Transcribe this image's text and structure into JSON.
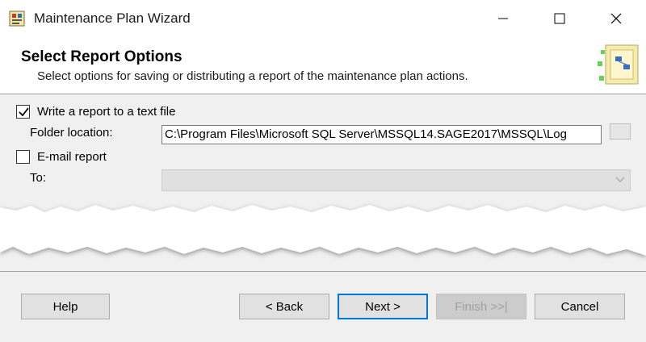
{
  "window": {
    "title": "Maintenance Plan Wizard"
  },
  "header": {
    "title": "Select Report Options",
    "subtitle": "Select options for saving or distributing a report of the maintenance plan actions."
  },
  "options": {
    "write_report_label": "Write a report to a text file",
    "write_report_checked": true,
    "folder_label": "Folder location:",
    "folder_value": "C:\\Program Files\\Microsoft SQL Server\\MSSQL14.SAGE2017\\MSSQL\\Log",
    "email_label": "E-mail report",
    "email_checked": false,
    "to_label": "To:",
    "to_value": ""
  },
  "footer": {
    "help_label": "Help",
    "back_label": "< Back",
    "next_label": "Next >",
    "finish_label": "Finish >>|",
    "cancel_label": "Cancel"
  },
  "colors": {
    "accent": "#0078d7",
    "panel": "#f0f0f0"
  }
}
